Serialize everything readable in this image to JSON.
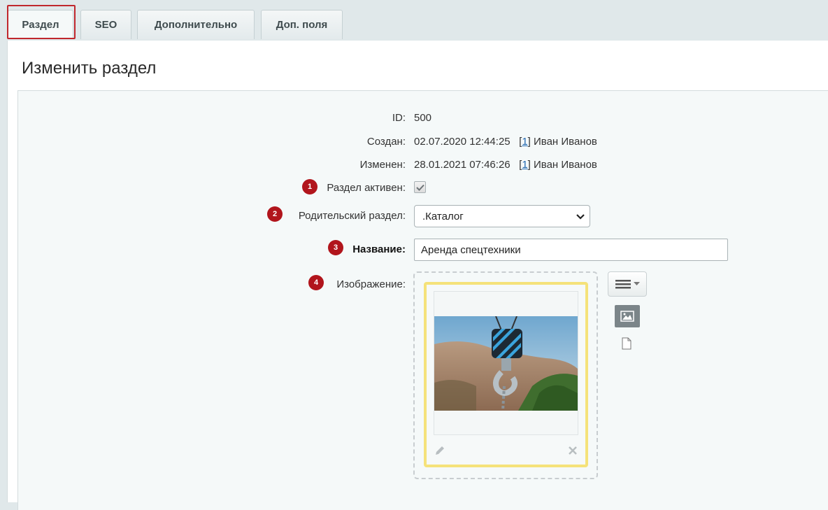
{
  "tabs": [
    {
      "label": "Раздел",
      "active": true
    },
    {
      "label": "SEO",
      "active": false
    },
    {
      "label": "Дополнительно",
      "active": false
    },
    {
      "label": "Доп. поля",
      "active": false
    }
  ],
  "page_title": "Изменить раздел",
  "fields": {
    "id": {
      "label": "ID:",
      "value": "500"
    },
    "created": {
      "label": "Создан:",
      "date": "02.07.2020 12:44:25",
      "user_id": "1",
      "user_name": "Иван Иванов"
    },
    "modified": {
      "label": "Изменен:",
      "date": "28.01.2021 07:46:26",
      "user_id": "1",
      "user_name": "Иван Иванов"
    },
    "active": {
      "label": "Раздел активен:",
      "checked": true,
      "badge": "1"
    },
    "parent": {
      "label": "Родительский раздел:",
      "value": ".Каталог",
      "badge": "2"
    },
    "name": {
      "label": "Название:",
      "value": "Аренда спецтехники",
      "badge": "3"
    },
    "image": {
      "label": "Изображение:",
      "badge": "4"
    }
  },
  "colors": {
    "badge": "#b1151c",
    "tab_highlight": "#c0272d",
    "link": "#2067b0",
    "image_frame": "#f5e27a"
  },
  "icons": [
    "check-icon",
    "chevron-down-icon",
    "menu-icon",
    "caret-down-icon",
    "image-icon",
    "file-icon",
    "pencil-icon",
    "close-icon"
  ]
}
